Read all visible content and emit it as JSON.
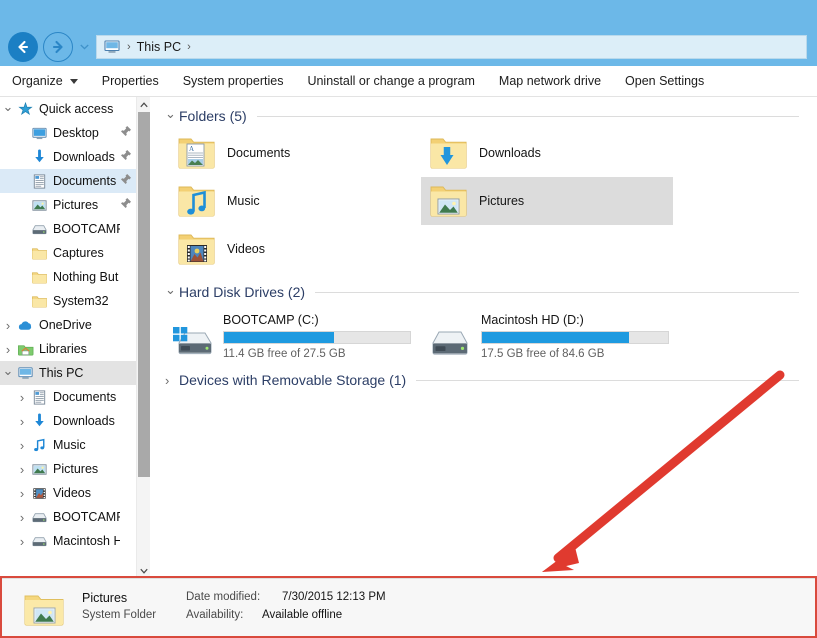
{
  "window": {
    "title_bar_color": "#6cb8e8",
    "accent_color": "#1e9ae0"
  },
  "nav": {
    "back_label": "Back",
    "forward_label": "Forward",
    "recent_label": "Recent locations",
    "address_icon": "this-pc-icon",
    "breadcrumbs": [
      "This PC"
    ],
    "separator": "›"
  },
  "toolbar": {
    "items": [
      {
        "label": "Organize",
        "has_caret": true
      },
      {
        "label": "Properties",
        "has_caret": false
      },
      {
        "label": "System properties",
        "has_caret": false
      },
      {
        "label": "Uninstall or change a program",
        "has_caret": false
      },
      {
        "label": "Map network drive",
        "has_caret": false
      },
      {
        "label": "Open Settings",
        "has_caret": false
      }
    ]
  },
  "sidebar": {
    "items": [
      {
        "label": "Quick access",
        "icon": "star-icon",
        "indent": 0,
        "chev": "open",
        "pinned": false,
        "selected": false
      },
      {
        "label": "Desktop",
        "icon": "desktop-icon",
        "indent": 1,
        "chev": "none",
        "pinned": true,
        "selected": false
      },
      {
        "label": "Downloads",
        "icon": "downloads-icon",
        "indent": 1,
        "chev": "none",
        "pinned": true,
        "selected": false
      },
      {
        "label": "Documents",
        "icon": "documents-icon",
        "indent": 1,
        "chev": "none",
        "pinned": true,
        "selected": "light"
      },
      {
        "label": "Pictures",
        "icon": "pictures-icon",
        "indent": 1,
        "chev": "none",
        "pinned": true,
        "selected": false
      },
      {
        "label": "BOOTCAMP (C:)",
        "icon": "drive-icon",
        "indent": 1,
        "chev": "none",
        "pinned": false,
        "selected": false
      },
      {
        "label": "Captures",
        "icon": "folder-icon",
        "indent": 1,
        "chev": "none",
        "pinned": false,
        "selected": false
      },
      {
        "label": "Nothing But the",
        "icon": "folder-icon",
        "indent": 1,
        "chev": "none",
        "pinned": false,
        "selected": false
      },
      {
        "label": "System32",
        "icon": "folder-icon",
        "indent": 1,
        "chev": "none",
        "pinned": false,
        "selected": false
      },
      {
        "label": "OneDrive",
        "icon": "onedrive-icon",
        "indent": 0,
        "chev": "closed",
        "pinned": false,
        "selected": false
      },
      {
        "label": "Libraries",
        "icon": "libraries-icon",
        "indent": 0,
        "chev": "closed",
        "pinned": false,
        "selected": false
      },
      {
        "label": "This PC",
        "icon": "this-pc-icon",
        "indent": 0,
        "chev": "open",
        "pinned": false,
        "selected": true
      },
      {
        "label": "Documents",
        "icon": "documents-icon",
        "indent": 1,
        "chev": "closed",
        "pinned": false,
        "selected": false
      },
      {
        "label": "Downloads",
        "icon": "downloads-icon",
        "indent": 1,
        "chev": "closed",
        "pinned": false,
        "selected": false
      },
      {
        "label": "Music",
        "icon": "music-icon",
        "indent": 1,
        "chev": "closed",
        "pinned": false,
        "selected": false
      },
      {
        "label": "Pictures",
        "icon": "pictures-icon",
        "indent": 1,
        "chev": "closed",
        "pinned": false,
        "selected": false
      },
      {
        "label": "Videos",
        "icon": "videos-icon",
        "indent": 1,
        "chev": "closed",
        "pinned": false,
        "selected": false
      },
      {
        "label": "BOOTCAMP (C:)",
        "icon": "drive-icon",
        "indent": 1,
        "chev": "closed",
        "pinned": false,
        "selected": false
      },
      {
        "label": "Macintosh HD (",
        "icon": "drive-icon",
        "indent": 1,
        "chev": "closed",
        "pinned": false,
        "selected": false
      }
    ],
    "scroll_up": "▲",
    "scroll_down": "▼"
  },
  "content": {
    "groups": [
      {
        "title": "Folders (5)",
        "expanded": true,
        "kind": "folders",
        "tiles": [
          {
            "label": "Documents",
            "icon": "documents-folder-icon",
            "selected": false
          },
          {
            "label": "Downloads",
            "icon": "downloads-folder-icon",
            "selected": false
          },
          {
            "label": "Music",
            "icon": "music-folder-icon",
            "selected": false
          },
          {
            "label": "Pictures",
            "icon": "pictures-folder-icon",
            "selected": true
          },
          {
            "label": "Videos",
            "icon": "videos-folder-icon",
            "selected": false
          }
        ]
      },
      {
        "title": "Hard Disk Drives (2)",
        "expanded": true,
        "kind": "drives",
        "drives": [
          {
            "name": "BOOTCAMP (C:)",
            "icon": "windows-drive-icon",
            "free_text": "11.4 GB free of 27.5 GB",
            "free_gb": 11.4,
            "total_gb": 27.5,
            "used_percent": 59
          },
          {
            "name": "Macintosh HD (D:)",
            "icon": "drive-icon",
            "free_text": "17.5 GB free of 84.6 GB",
            "free_gb": 17.5,
            "total_gb": 84.6,
            "used_percent": 79
          }
        ]
      },
      {
        "title": "Devices with Removable Storage (1)",
        "expanded": false,
        "kind": "empty"
      }
    ]
  },
  "details": {
    "icon": "pictures-folder-icon",
    "name": "Pictures",
    "type": "System Folder",
    "fields": [
      {
        "key": "Date modified:",
        "value": "7/30/2015 12:13 PM"
      },
      {
        "key": "Availability:",
        "value": "Available offline"
      }
    ]
  },
  "annotation": {
    "arrow_color": "#e03a2f",
    "box_color": "#d94a3d",
    "target": "details-pane"
  }
}
